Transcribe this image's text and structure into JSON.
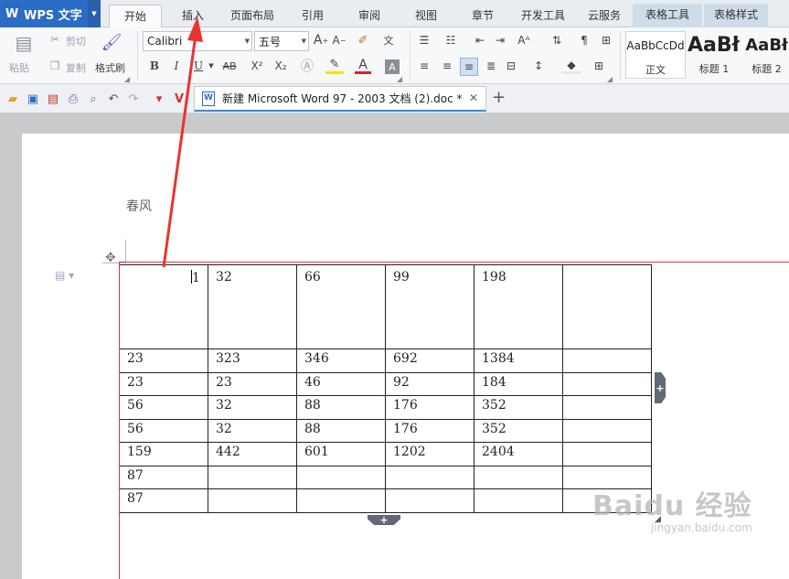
{
  "app": {
    "title": "WPS 文字"
  },
  "tabs": [
    {
      "label": "开始",
      "active": true
    },
    {
      "label": "插入"
    },
    {
      "label": "页面布局"
    },
    {
      "label": "引用"
    },
    {
      "label": "审阅"
    },
    {
      "label": "视图"
    },
    {
      "label": "章节"
    },
    {
      "label": "开发工具"
    },
    {
      "label": "云服务"
    },
    {
      "label": "表格工具",
      "contextual": true
    },
    {
      "label": "表格样式",
      "contextual": true
    }
  ],
  "ribbon": {
    "clipboard": {
      "paste": "粘贴",
      "cut": "剪切",
      "copy": "复制",
      "format_painter": "格式刷"
    },
    "font": {
      "family": "Calibri",
      "size": "五号",
      "bold": "B",
      "italic": "I",
      "underline": "U",
      "strike": "AB",
      "superscript": "X²",
      "subscript": "X₂",
      "font_color": "A",
      "pinyin": "文"
    },
    "styles": [
      {
        "sample": "AaBbCcDd",
        "name": "正文"
      },
      {
        "sample": "AaBł",
        "name": "标题 1"
      },
      {
        "sample": "AaBł",
        "name": "标题 2"
      }
    ]
  },
  "document": {
    "tab_title": "新建 Microsoft Word 97 - 2003 文档 (2).doc *",
    "heading": "春风",
    "table": [
      [
        "1",
        "32",
        "66",
        "99",
        "198",
        ""
      ],
      [
        "23",
        "323",
        "346",
        "692",
        "1384",
        ""
      ],
      [
        "23",
        "23",
        "46",
        "92",
        "184",
        ""
      ],
      [
        "56",
        "32",
        "88",
        "176",
        "352",
        ""
      ],
      [
        "56",
        "32",
        "88",
        "176",
        "352",
        ""
      ],
      [
        "159",
        "442",
        "601",
        "1202",
        "2404",
        ""
      ],
      [
        "87",
        "",
        "",
        "",
        "",
        ""
      ],
      [
        "87",
        "",
        "",
        "",
        "",
        ""
      ]
    ]
  },
  "watermark": {
    "main": "Baidu 经验",
    "sub": "jingyan.baidu.com"
  },
  "colors": {
    "accent": "#2b6cc4",
    "contextual_tab": "#cfdcea",
    "guide": "#d9363e",
    "annotation": "#e8342f"
  }
}
